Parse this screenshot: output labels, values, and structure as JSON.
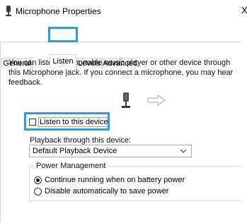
{
  "window": {
    "title": "Microphone Properties",
    "close_glyph": "X"
  },
  "tabs": [
    {
      "label": "General",
      "active": false
    },
    {
      "label": "Listen",
      "active": true
    },
    {
      "label": "Levels",
      "active": false
    },
    {
      "label": "Advanced",
      "active": false
    }
  ],
  "listen": {
    "description": "You can listen to a portable music player or other device through this Microphone jack.  If you connect a microphone, you may hear feedback.",
    "listen_checkbox": {
      "label": "Listen to this device",
      "checked": false
    },
    "playback_label": "Playback through this device:",
    "playback_select": {
      "value": "Default Playback Device"
    },
    "power_management": {
      "title": "Power Management",
      "options": [
        {
          "label": "Continue running when on battery power",
          "selected": true
        },
        {
          "label": "Disable automatically to save power",
          "selected": false
        }
      ]
    }
  },
  "icons": {
    "title": "microphone-icon",
    "illustration": "microphone-icon",
    "arrow": "arrow-right-icon",
    "dropdown": "chevron-down-icon"
  },
  "colors": {
    "highlight": "#2e9bdc",
    "tab_border": "#d9d9d9",
    "arrow": "#bfbfbf"
  }
}
